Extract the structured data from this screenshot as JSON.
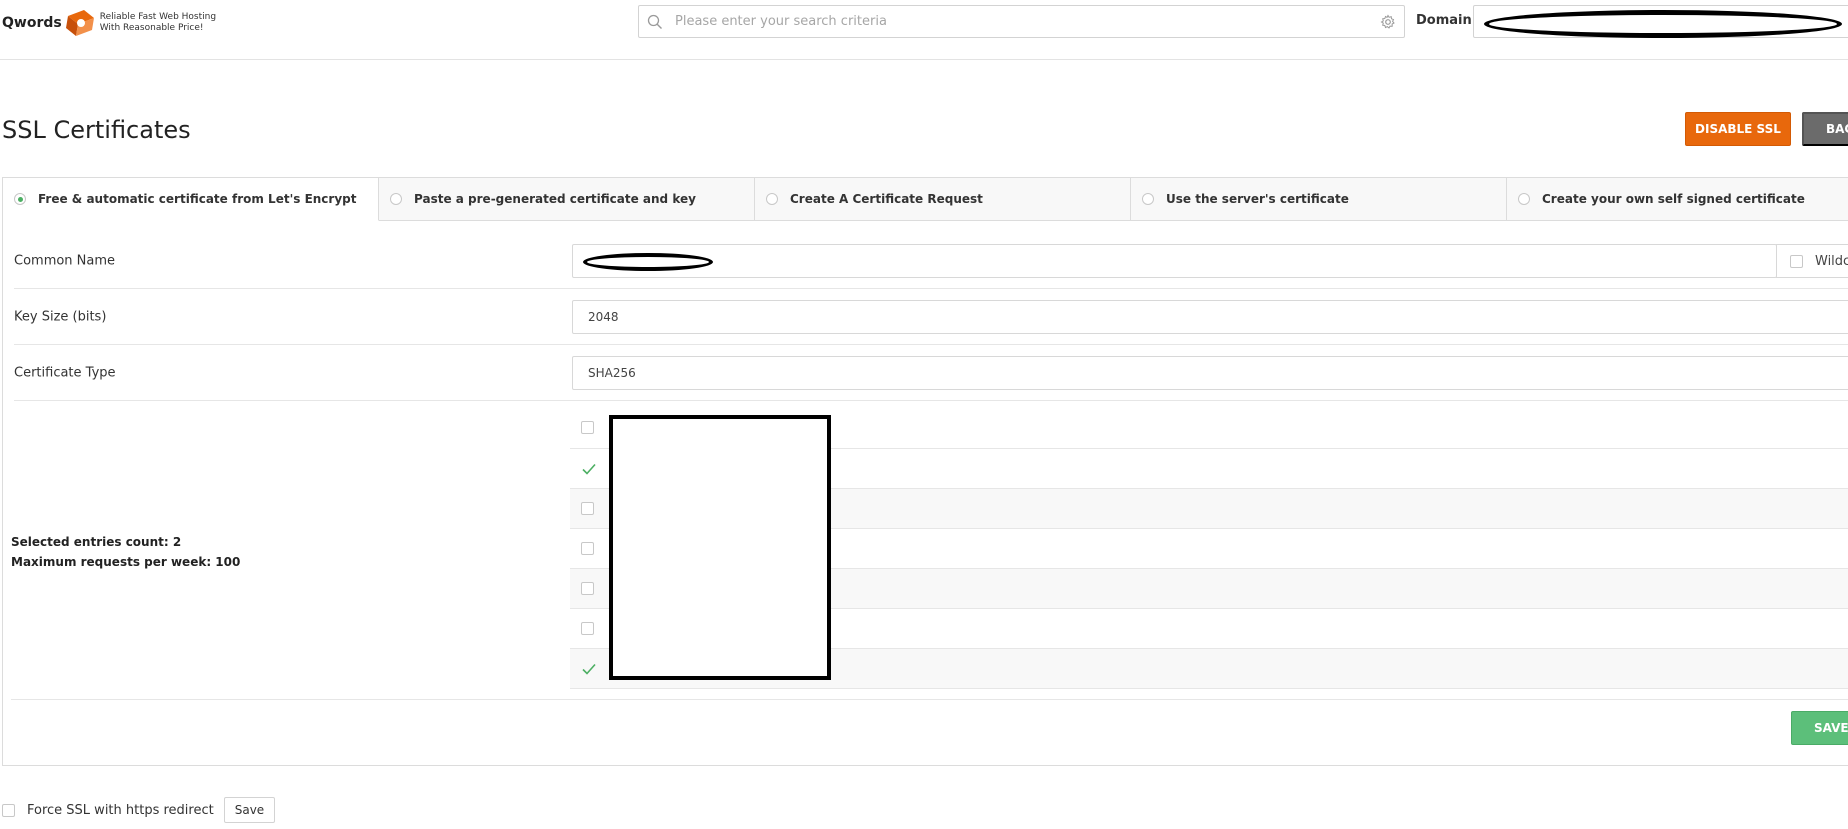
{
  "header": {
    "logo_text": "Qwords",
    "tagline_line1": "Reliable Fast Web Hosting",
    "tagline_line2": "With Reasonable Price!",
    "search_placeholder": "Please enter your search criteria",
    "domain_label": "Domain"
  },
  "page": {
    "title": "SSL Certificates",
    "disable_ssl_label": "DISABLE SSL",
    "back_label": "BAC"
  },
  "tabs": [
    {
      "label": "Free & automatic certificate from Let's Encrypt",
      "selected": true
    },
    {
      "label": "Paste a pre-generated certificate and key",
      "selected": false
    },
    {
      "label": "Create A Certificate Request",
      "selected": false
    },
    {
      "label": "Use the server's certificate",
      "selected": false
    },
    {
      "label": "Create your own self signed certificate",
      "selected": false
    }
  ],
  "form": {
    "common_name_label": "Common Name",
    "wildcard_label": "Wildcar",
    "key_size_label": "Key Size (bits)",
    "key_size_value": "2048",
    "cert_type_label": "Certificate Type",
    "cert_type_value": "SHA256",
    "selected_count_text": "Selected entries count: 2",
    "max_requests_text": "Maximum requests per week: 100",
    "entries": [
      {
        "checked": false
      },
      {
        "checked": true
      },
      {
        "checked": false
      },
      {
        "checked": false
      },
      {
        "checked": false
      },
      {
        "checked": false
      },
      {
        "checked": true
      }
    ],
    "save_label": "SAVE"
  },
  "footer": {
    "force_ssl_label": "Force SSL with https redirect",
    "save_label": "Save"
  },
  "colors": {
    "disable_button": "#e8680c",
    "back_button": "#6b6b6b",
    "save_button": "#5cbf7a",
    "check_green": "#4caf63"
  }
}
